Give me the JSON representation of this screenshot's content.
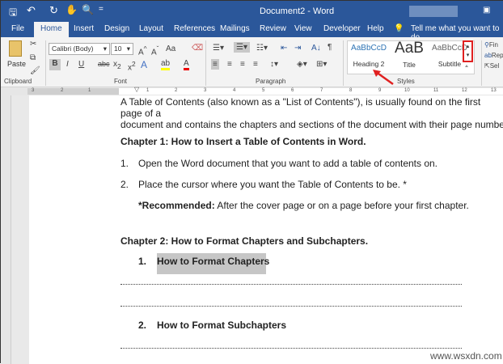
{
  "titlebar": {
    "title": "Document2  -  Word"
  },
  "tabs": [
    "File",
    "Home",
    "Insert",
    "Design",
    "Layout",
    "References",
    "Mailings",
    "Review",
    "View",
    "Developer",
    "Help"
  ],
  "tell_me": "Tell me what you want to do",
  "clipboard": {
    "paste": "Paste",
    "label": "Clipboard"
  },
  "font": {
    "name": "Calibri (Body)",
    "size": "10",
    "label": "Font",
    "case": "Aa"
  },
  "paragraph": {
    "label": "Paragraph"
  },
  "styles": {
    "label": "Styles",
    "items": [
      {
        "preview": "AaBbCcD",
        "name": "Heading 2"
      },
      {
        "preview": "AaB",
        "name": "Title"
      },
      {
        "preview": "AaBbCcD",
        "name": "Subtitle"
      }
    ]
  },
  "editing": {
    "find": "Fin",
    "replace": "Rep",
    "select": "Sel"
  },
  "ruler": [
    "3",
    "2",
    "1",
    "1",
    "2",
    "3",
    "4",
    "5",
    "6",
    "7",
    "8",
    "9",
    "10",
    "11",
    "12",
    "13"
  ],
  "document": {
    "intro1": "A Table of Contents (also known as a \"List of Contents\"), is usually found on the first page of a",
    "intro2": "document and contains the chapters and sections of the document with their page numbers.",
    "ch1": "Chapter 1: How to Insert a Table of Contents in Word.",
    "step1_num": "1.",
    "step1": "Open the Word document that you want to add a table of contents on.",
    "step2_num": "2.",
    "step2": "Place the cursor where you want the Table of Contents to be. *",
    "rec_label": "*Recommended:",
    "rec_text": " After the cover page or on a page before your first chapter.",
    "ch2": "Chapter 2: How to Format Chapters and Subchapters.",
    "sub1_num": "1.",
    "sub1": "How to Format Chapters",
    "sub2_num": "2.",
    "sub2": "How to Format Subchapters"
  },
  "watermark": "www.wsxdn.com"
}
